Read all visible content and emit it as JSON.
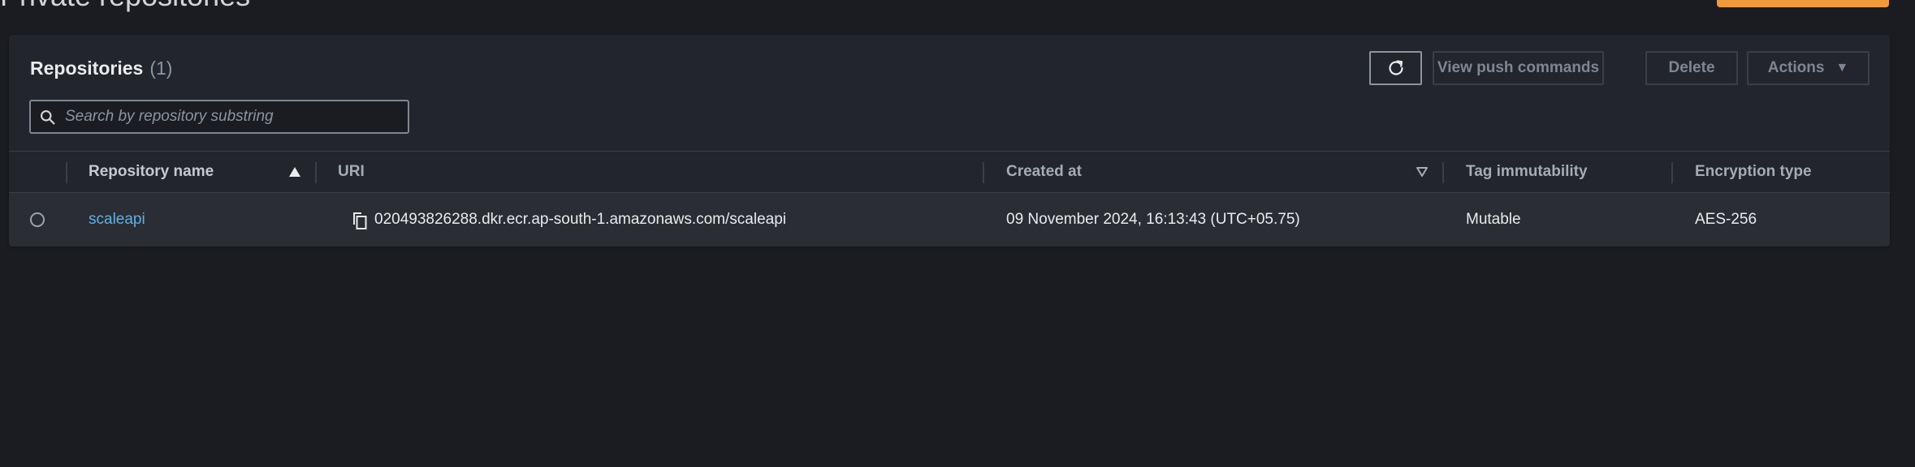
{
  "page": {
    "title": "Private repositories"
  },
  "colors": {
    "background": "#1b1c21",
    "panel": "#22252c",
    "row": "#2a2d33",
    "primary_button": "#f09a3c",
    "link": "#5fb1e6"
  },
  "panel": {
    "title": "Repositories",
    "count": "(1)"
  },
  "toolbar": {
    "refresh_icon": "refresh-icon",
    "view_push_label": "View push commands",
    "delete_label": "Delete",
    "actions_label": "Actions",
    "actions_caret": "▼"
  },
  "search": {
    "placeholder": "Search by repository substring",
    "value": "",
    "icon": "search-icon"
  },
  "table": {
    "columns": [
      {
        "label": "Repository name",
        "sort": "ascending"
      },
      {
        "label": "URI"
      },
      {
        "label": "Created at",
        "sort": "sortable"
      },
      {
        "label": "Tag immutability"
      },
      {
        "label": "Encryption type"
      }
    ],
    "rows": [
      {
        "selected": false,
        "name": "scaleapi",
        "uri": "020493826288.dkr.ecr.ap-south-1.amazonaws.com/scaleapi",
        "created_at": "09 November 2024, 16:13:43 (UTC+05.75)",
        "tag_immutability": "Mutable",
        "encryption_type": "AES-256"
      }
    ]
  }
}
